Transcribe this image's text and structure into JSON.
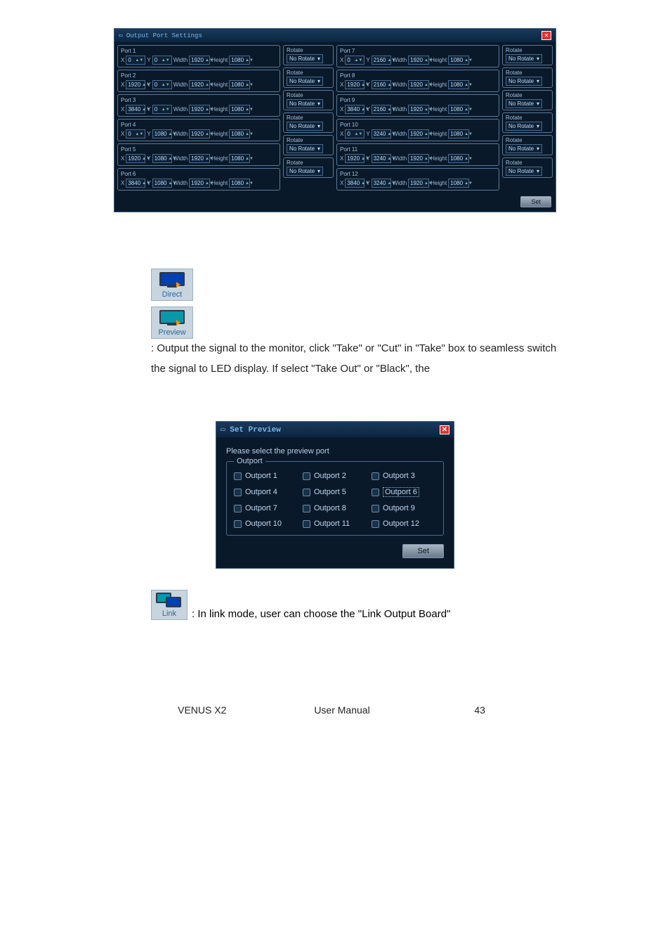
{
  "ops": {
    "title": "Output Port Settings",
    "labels": {
      "x": "X",
      "y": "Y",
      "w": "Width",
      "h": "Height",
      "rotate": "Rotate",
      "rotate_val": "No Rotate",
      "set": "Set"
    },
    "left": [
      {
        "name": "Port 1",
        "x": "0",
        "y": "0",
        "w": "1920",
        "h": "1080"
      },
      {
        "name": "Port 2",
        "x": "1920",
        "y": "0",
        "w": "1920",
        "h": "1080"
      },
      {
        "name": "Port 3",
        "x": "3840",
        "y": "0",
        "w": "1920",
        "h": "1080"
      },
      {
        "name": "Port 4",
        "x": "0",
        "y": "1080",
        "w": "1920",
        "h": "1080"
      },
      {
        "name": "Port 5",
        "x": "1920",
        "y": "1080",
        "w": "1920",
        "h": "1080"
      },
      {
        "name": "Port 6",
        "x": "3840",
        "y": "1080",
        "w": "1920",
        "h": "1080"
      }
    ],
    "right": [
      {
        "name": "Port 7",
        "x": "0",
        "y": "2160",
        "w": "1920",
        "h": "1080"
      },
      {
        "name": "Port 8",
        "x": "1920",
        "y": "2160",
        "w": "1920",
        "h": "1080"
      },
      {
        "name": "Port 9",
        "x": "3840",
        "y": "2160",
        "w": "1920",
        "h": "1080"
      },
      {
        "name": "Port 10",
        "x": "0",
        "y": "3240",
        "w": "1920",
        "h": "1080"
      },
      {
        "name": "Port 11",
        "x": "1920",
        "y": "3240",
        "w": "1920",
        "h": "1080"
      },
      {
        "name": "Port 12",
        "x": "3840",
        "y": "3240",
        "w": "1920",
        "h": "1080"
      }
    ]
  },
  "icons": {
    "direct": "Direct",
    "preview": "Preview",
    "link": "Link"
  },
  "para1": ": Output the signal to the monitor, click \"Take\" or \"Cut\" in \"Take\" box to seamless switch the signal to LED display. If select \"Take Out\" or \"Black\", the",
  "sp": {
    "title": "Set Preview",
    "hint": "Please select the preview port",
    "group": "Outport",
    "items": [
      "Outport 1",
      "Outport 2",
      "Outport 3",
      "Outport 4",
      "Outport 5",
      "Outport 6",
      "Outport 7",
      "Outport 8",
      "Outport 9",
      "Outport 10",
      "Outport 11",
      "Outport 12"
    ],
    "selected_index": 5,
    "set": "Set"
  },
  "para2": ": In link mode, user can choose the \"Link Output Board\"",
  "footer": {
    "left": "VENUS X2",
    "center": "User Manual",
    "right": "43"
  }
}
